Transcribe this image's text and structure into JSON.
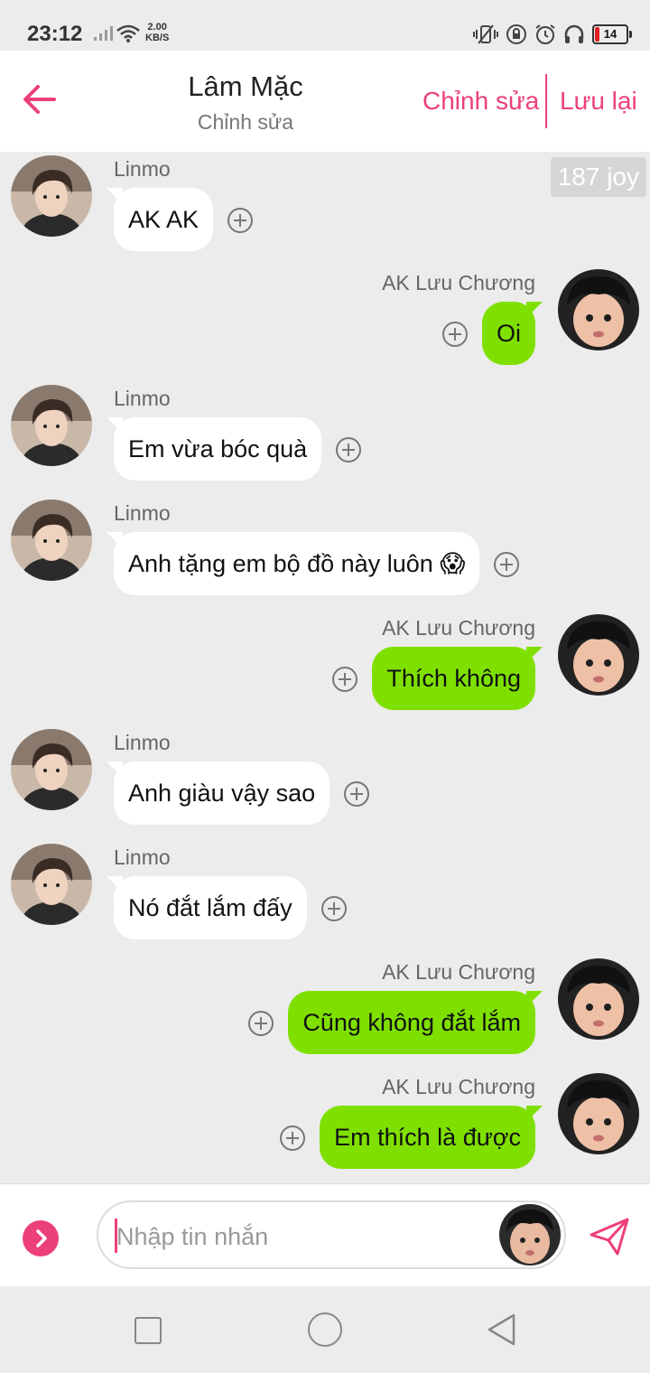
{
  "status_bar": {
    "time": "23:12",
    "net_speed_value": "2.00",
    "net_speed_unit": "KB/S",
    "battery": "14"
  },
  "header": {
    "title": "Lâm Mặc",
    "subtitle": "Chỉnh sửa",
    "edit_label": "Chỉnh sửa",
    "save_label": "Lưu lại",
    "accent_color": "#ec407a"
  },
  "chat": {
    "badge": "187 joy",
    "messages": [
      {
        "side": "left",
        "sender": "Linmo",
        "text": "AK AK"
      },
      {
        "side": "right",
        "sender": "AK Lưu Chương",
        "text": "Oi"
      },
      {
        "side": "left",
        "sender": "Linmo",
        "text": "Em vừa bóc quà"
      },
      {
        "side": "left",
        "sender": "Linmo",
        "text": "Anh tặng em bộ đồ này luôn 😱"
      },
      {
        "side": "right",
        "sender": "AK Lưu Chương",
        "text": "Thích không"
      },
      {
        "side": "left",
        "sender": "Linmo",
        "text": "Anh giàu vậy sao"
      },
      {
        "side": "left",
        "sender": "Linmo",
        "text": "Nó đắt lắm đấy"
      },
      {
        "side": "right",
        "sender": "AK Lưu Chương",
        "text": "Cũng không đắt lắm"
      },
      {
        "side": "right",
        "sender": "AK Lưu Chương",
        "text": "Em thích là được"
      }
    ],
    "bubble_colors": {
      "incoming": "#ffffff",
      "outgoing": "#7fe000"
    }
  },
  "composer": {
    "placeholder": "Nhập tin nhắn"
  }
}
